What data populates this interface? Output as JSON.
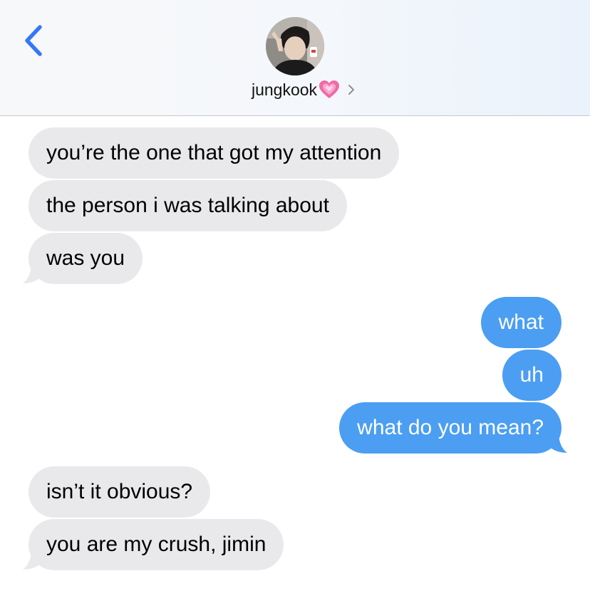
{
  "header": {
    "contact_name": "jungkook",
    "contact_emoji": "💗"
  },
  "icons": {
    "back": "chevron-left-icon",
    "disclosure": "chevron-right-icon",
    "emoji": "growing-heart-icon"
  },
  "colors": {
    "incoming_bubble": "#e9e9eb",
    "outgoing_bubble": "#4b9ef2",
    "back_accent": "#3478f6"
  },
  "messages": [
    {
      "direction": "incoming",
      "text": "you’re the one that got my attention"
    },
    {
      "direction": "incoming",
      "text": "the person i was talking about"
    },
    {
      "direction": "incoming",
      "text": "was you"
    },
    {
      "direction": "outgoing",
      "text": "what"
    },
    {
      "direction": "outgoing",
      "text": "uh"
    },
    {
      "direction": "outgoing",
      "text": "what do you mean?"
    },
    {
      "direction": "incoming",
      "text": "isn’t it obvious?"
    },
    {
      "direction": "incoming",
      "text": "you are my crush, jimin"
    }
  ]
}
